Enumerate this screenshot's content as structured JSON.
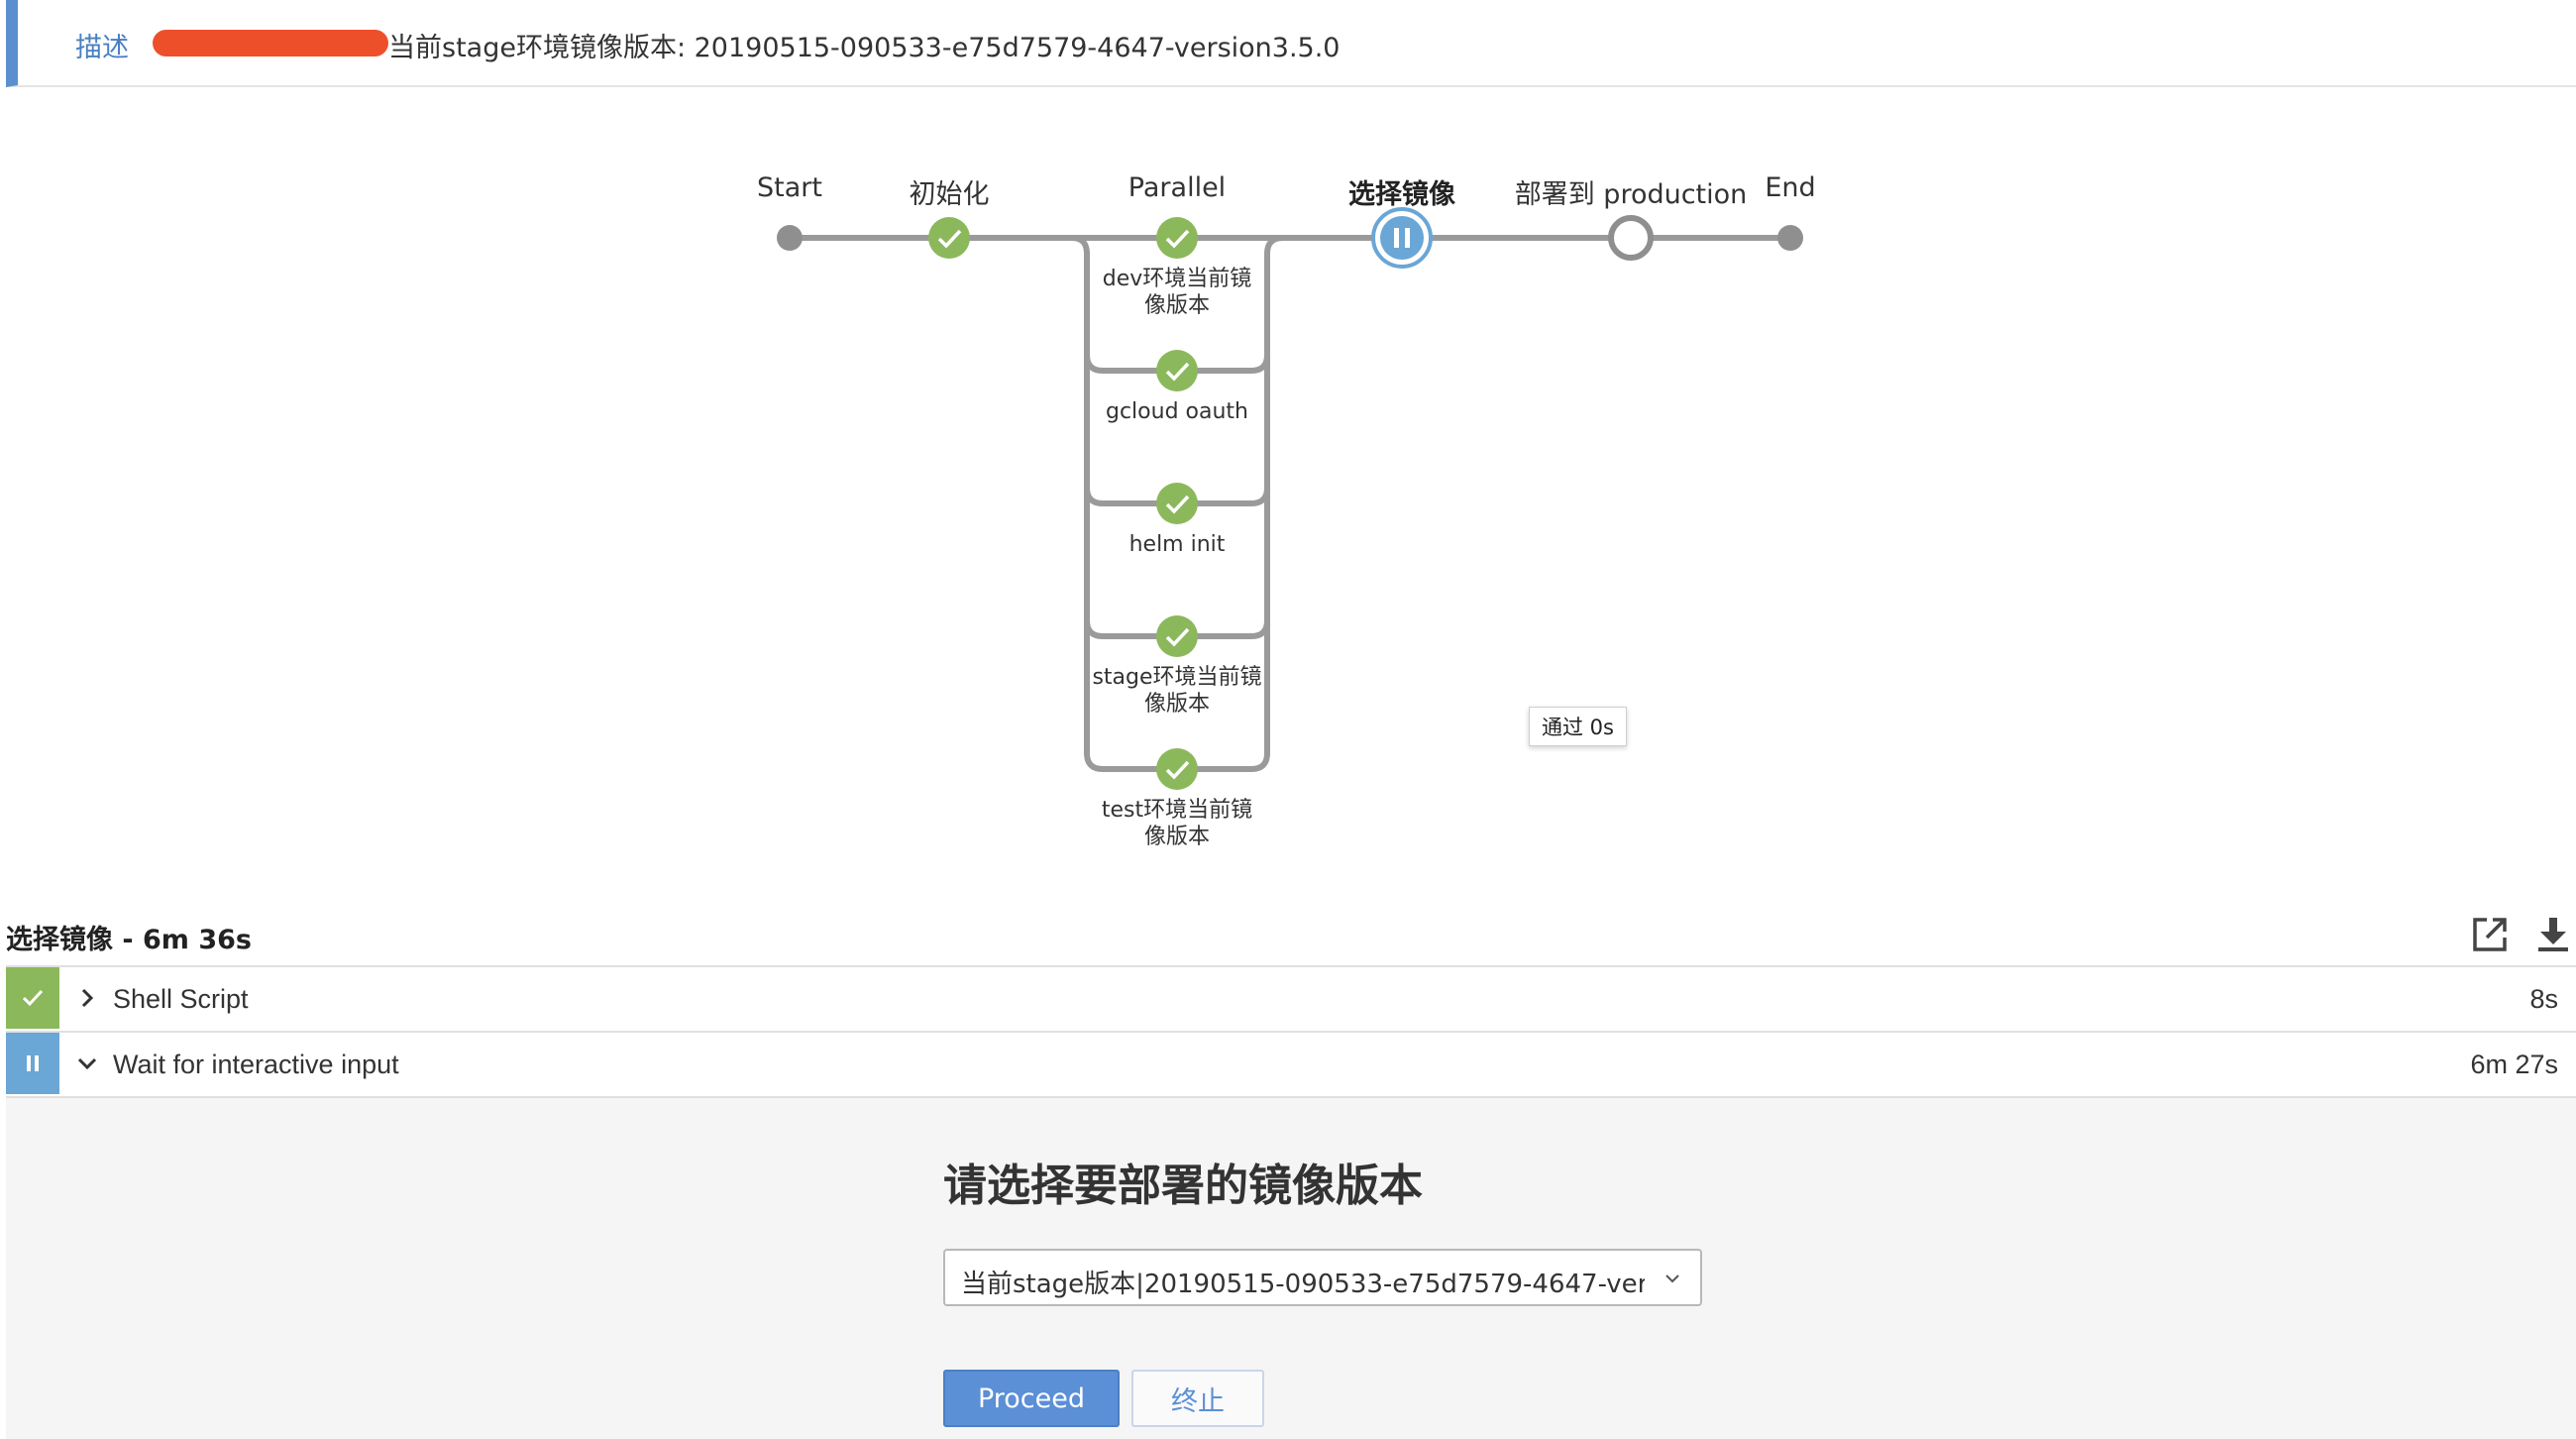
{
  "description": {
    "label": "描述",
    "text": "当前stage环境镜像版本: 20190515-090533-e75d7579-4647-version3.5.0"
  },
  "pipeline": {
    "stages": [
      {
        "label": "Start",
        "status": "start"
      },
      {
        "label": "初始化",
        "status": "success"
      },
      {
        "label": "Parallel",
        "status": "success"
      },
      {
        "label": "选择镜像",
        "status": "paused"
      },
      {
        "label": "部署到 production",
        "status": "not-built"
      },
      {
        "label": "End",
        "status": "end"
      }
    ],
    "branches": [
      {
        "label": "dev环境当前镜像版本",
        "status": "success"
      },
      {
        "label": "gcloud oauth",
        "status": "success"
      },
      {
        "label": "helm init",
        "status": "success"
      },
      {
        "label": "stage环境当前镜像版本",
        "status": "success"
      },
      {
        "label": "test环境当前镜像版本",
        "status": "success"
      }
    ],
    "tooltip": "通过 0s"
  },
  "stage_detail": {
    "title": "选择镜像 - 6m 36s",
    "icons": [
      "open-external-icon",
      "download-icon"
    ]
  },
  "steps": [
    {
      "name": "Shell Script",
      "duration": "8s",
      "status": "success",
      "expanded": false
    },
    {
      "name": "Wait for interactive input",
      "duration": "6m 27s",
      "status": "paused",
      "expanded": true
    }
  ],
  "input": {
    "title": "请选择要部署的镜像版本",
    "selected": "当前stage版本|20190515-090533-e75d7579-4647-versi...",
    "proceed_label": "Proceed",
    "abort_label": "终止"
  },
  "colors": {
    "success": "#8cb85c",
    "paused": "#6aa6d6",
    "accent": "#5b8fcf",
    "redaction": "#ee4f2b"
  }
}
